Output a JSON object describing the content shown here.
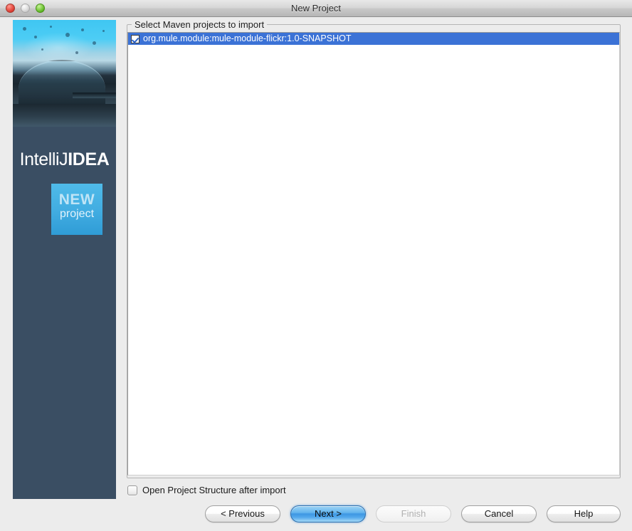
{
  "window": {
    "title": "New Project",
    "traffic_lights": [
      "close-button",
      "minimize-button",
      "zoom-button"
    ]
  },
  "sidebar": {
    "logo_thin": "IntelliJ",
    "logo_bold": "IDEA",
    "badge_line1": "NEW",
    "badge_line2": "project",
    "background_color": "#3a4e63",
    "badge_color": "#41ace1"
  },
  "main": {
    "group_title": "Select Maven projects to import",
    "selection_color": "#3b72d6",
    "list": [
      {
        "label": "org.mule.module:mule-module-flickr:1.0-SNAPSHOT",
        "checked": true,
        "selected": true
      }
    ],
    "footer_checkbox": {
      "label": "Open Project Structure after import",
      "checked": false
    }
  },
  "buttons": {
    "previous": "< Previous",
    "next": "Next >",
    "finish": "Finish",
    "cancel": "Cancel",
    "help": "Help"
  }
}
